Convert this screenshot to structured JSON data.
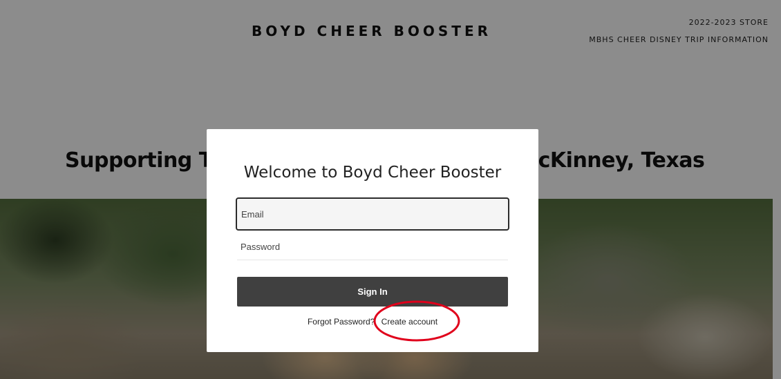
{
  "header": {
    "site_title": "BOYD CHEER BOOSTER",
    "nav": [
      {
        "label": "2022-2023 STORE"
      },
      {
        "label": "MBHS CHEER DISNEY TRIP INFORMATION"
      }
    ]
  },
  "hero": {
    "heading": "Supporting The Boyd Cheer Program in McKinney, Texas"
  },
  "modal": {
    "title": "Welcome to Boyd Cheer Booster",
    "email_placeholder": "Email",
    "password_placeholder": "Password",
    "signin_label": "Sign In",
    "forgot_label": "Forgot Password?",
    "create_label": "Create account"
  },
  "colors": {
    "overlay": "rgba(0,0,0,0.45)",
    "button_bg": "#404040",
    "annotation": "#e0001b"
  }
}
